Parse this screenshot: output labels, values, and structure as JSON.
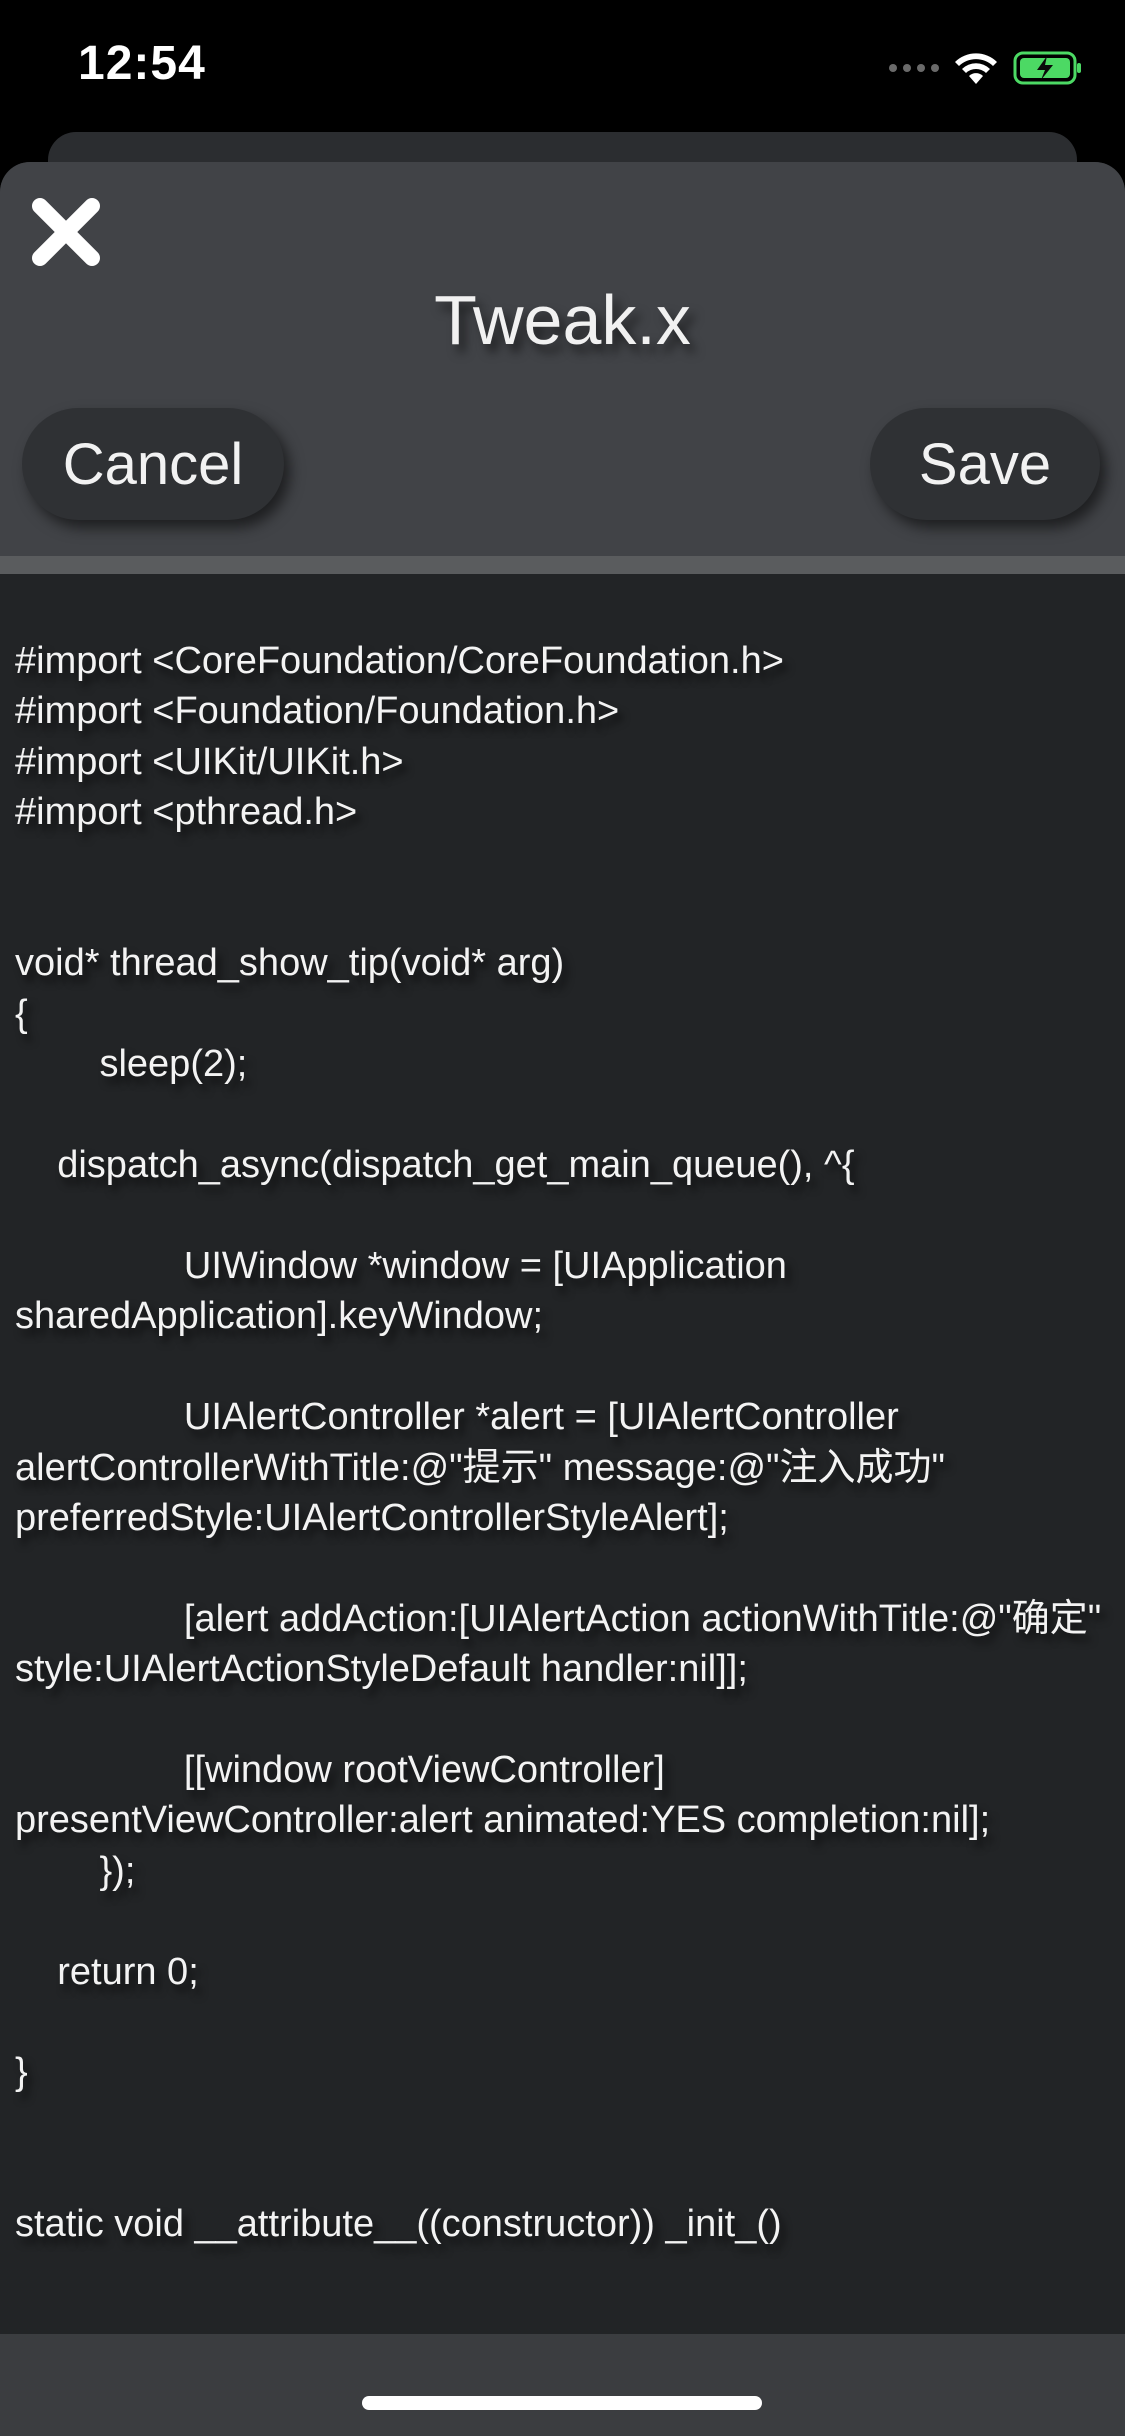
{
  "status_bar": {
    "time": "12:54",
    "icons": [
      "cellular-signal-icon",
      "wifi-icon",
      "battery-charging-icon"
    ],
    "battery_color": "#4cd964"
  },
  "editor": {
    "title": "Tweak.x",
    "close_icon": "close-icon",
    "cancel_label": "Cancel",
    "save_label": "Save",
    "code": "#import <CoreFoundation/CoreFoundation.h>\n#import <Foundation/Foundation.h>\n#import <UIKit/UIKit.h>\n#import <pthread.h>\n\n\nvoid* thread_show_tip(void* arg)\n{\n        sleep(2);\n\n    dispatch_async(dispatch_get_main_queue(), ^{\n\n                UIWindow *window = [UIApplication sharedApplication].keyWindow;\n\n                UIAlertController *alert = [UIAlertController alertControllerWithTitle:@\"提示\" message:@\"注入成功\" preferredStyle:UIAlertControllerStyleAlert];\n\n                [alert addAction:[UIAlertAction actionWithTitle:@\"确定\" style:UIAlertActionStyleDefault handler:nil]];\n\n                [[window rootViewController] presentViewController:alert animated:YES completion:nil];\n        });\n\n    return 0;\n\n}\n\n\nstatic void __attribute__((constructor)) _init_()"
  },
  "colors": {
    "header_background": "#414347",
    "editor_background": "#222426",
    "text": "#f3f3f3"
  }
}
